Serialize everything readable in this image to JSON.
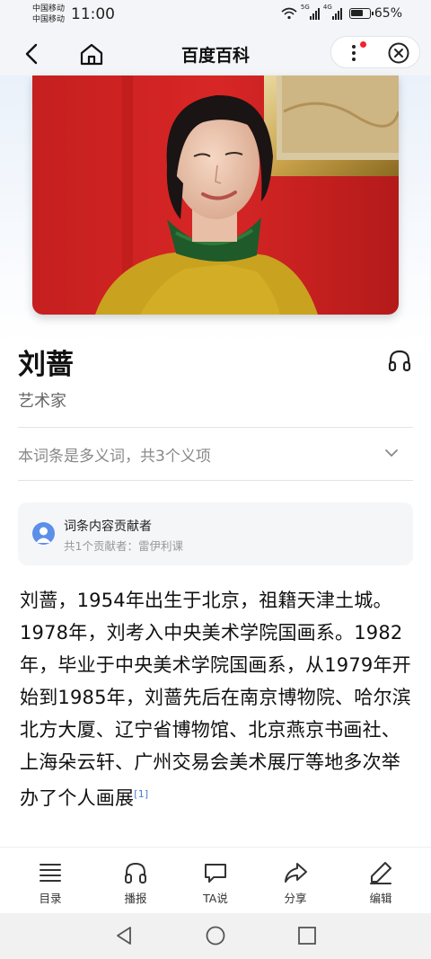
{
  "status_bar": {
    "carrier_1": "中国移动",
    "carrier_2": "中国移动",
    "time": "11:00",
    "signal_1_tag": "5G",
    "signal_2_tag": "4G",
    "battery": "65%"
  },
  "header": {
    "title": "百度百科",
    "back_icon": "chevron-left-icon",
    "home_icon": "home-icon",
    "more_icon": "more-vertical-icon",
    "close_icon": "close-circle-icon",
    "notification_dot_color": "#f5222d"
  },
  "entry": {
    "name": "刘蔷",
    "category": "艺术家",
    "polysemy_note": "本词条是多义词，共3个义项",
    "listen_icon": "headphones-icon"
  },
  "contributors": {
    "title": "词条内容贡献者",
    "subtitle": "共1个贡献者：雷伊利课"
  },
  "article": {
    "text": "刘蔷，1954年出生于北京，祖籍天津土城。1978年，刘考入中央美术学院国画系。1982年，毕业于中央美术学院国画系，从1979年开始到1985年，刘蔷先后在南京博物院、哈尔滨北方大厦、辽宁省博物馆、北京燕京书画社、上海朵云轩、广州交易会美术展厅等地多次举办了个人画展",
    "ref": "[1]"
  },
  "toolbar": {
    "items": [
      {
        "label": "目录",
        "icon": "list-icon"
      },
      {
        "label": "播报",
        "icon": "headphones-icon"
      },
      {
        "label": "TA说",
        "icon": "chat-bubble-icon"
      },
      {
        "label": "分享",
        "icon": "share-arrow-icon"
      },
      {
        "label": "编辑",
        "icon": "pencil-icon"
      }
    ]
  },
  "navbar": {
    "back_icon": "triangle-back-icon",
    "home_icon": "circle-home-icon",
    "recent_icon": "square-recent-icon"
  },
  "colors": {
    "accent": "#4a7cd8",
    "text": "#111111",
    "muted": "#888888"
  }
}
